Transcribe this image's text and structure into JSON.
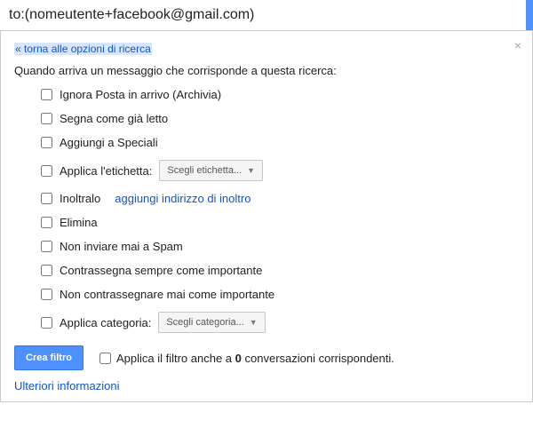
{
  "search": {
    "value": "to:(nomeutente+facebook@gmail.com)"
  },
  "panel": {
    "back": "« torna alle opzioni di ricerca",
    "intro": "Quando arriva un messaggio che corrisponde a questa ricerca:",
    "opts": {
      "archive": "Ignora Posta in arrivo (Archivia)",
      "read": "Segna come già letto",
      "star": "Aggiungi a Speciali",
      "label": "Applica l'etichetta:",
      "labelDropdown": "Scegli etichetta...",
      "forward": "Inoltralo",
      "forwardLink": "aggiungi indirizzo di inoltro",
      "delete": "Elimina",
      "noSpam": "Non inviare mai a Spam",
      "important": "Contrassegna sempre come importante",
      "notImportant": "Non contrassegnare mai come importante",
      "category": "Applica categoria:",
      "categoryDropdown": "Scegli categoria..."
    },
    "footer": {
      "createBtn": "Crea filtro",
      "applyPrefix": "Applica il filtro anche a ",
      "applyCount": "0",
      "applySuffix": " conversazioni corrispondenti."
    },
    "more": "Ulteriori informazioni",
    "close": "×"
  }
}
